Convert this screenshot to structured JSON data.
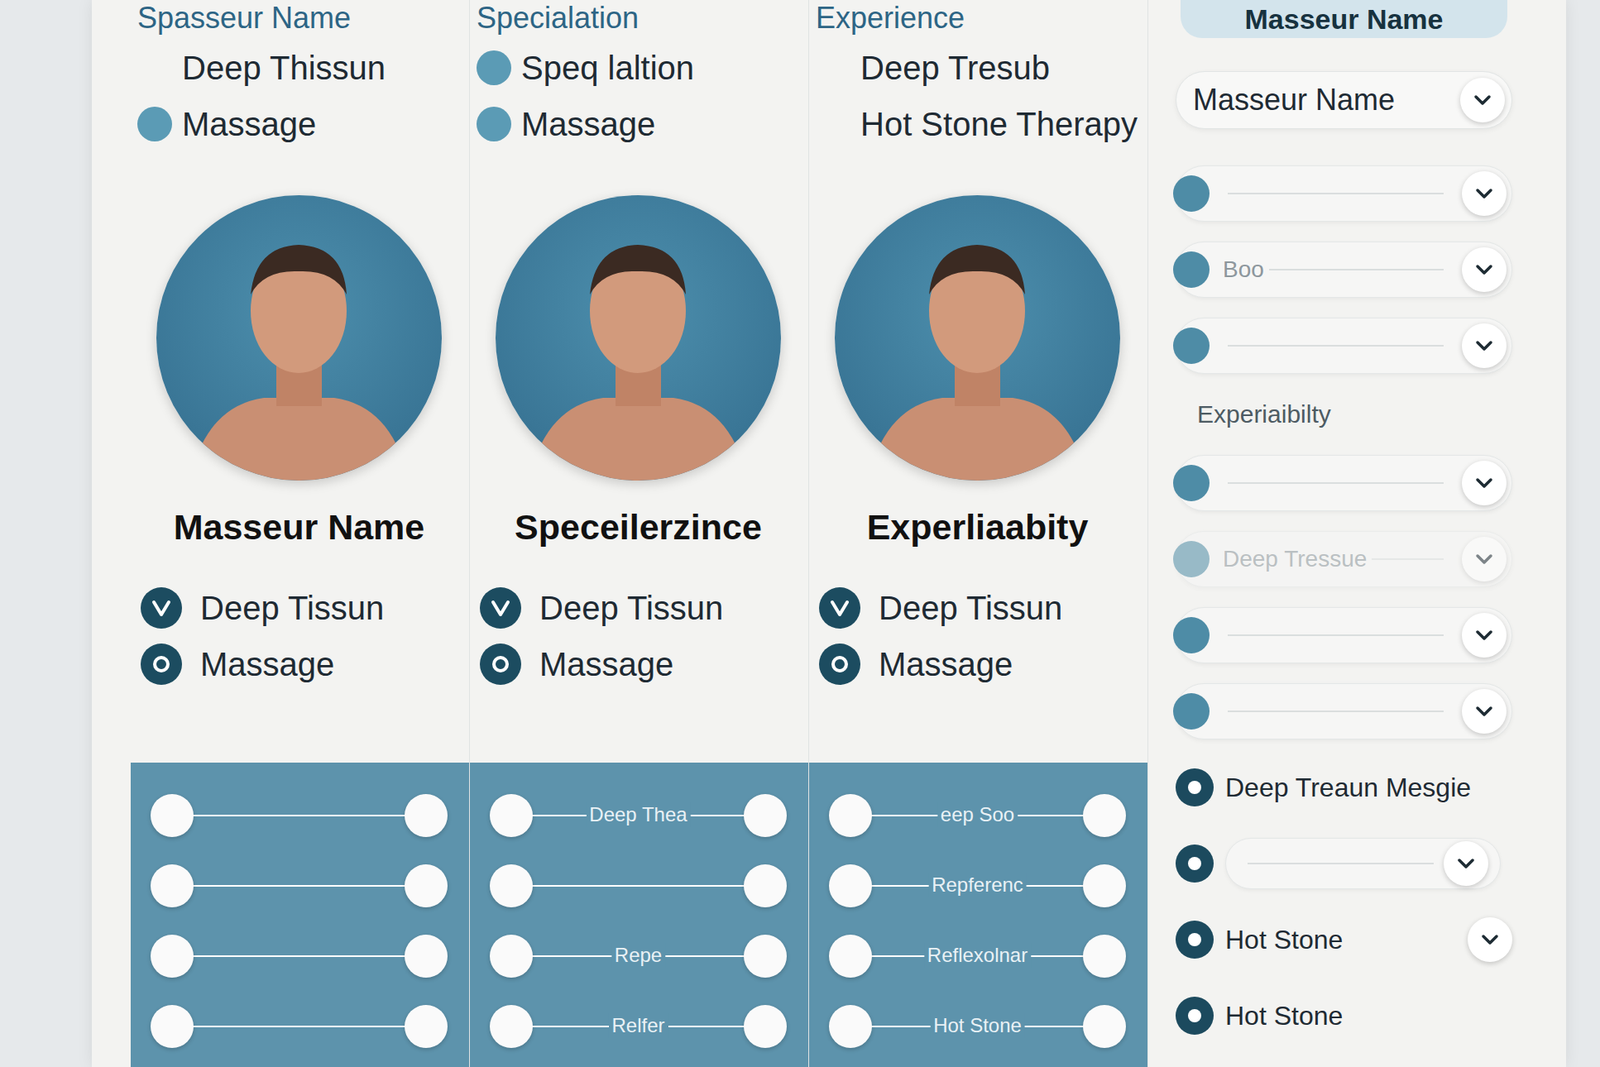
{
  "columns": [
    {
      "header": "Spasseur Name",
      "top_items": [
        {
          "text": "Deep Thissun",
          "bullet": false
        },
        {
          "text": "Massage",
          "bullet": true
        }
      ],
      "name": "Masseur Name",
      "items": [
        "Deep Tissun",
        "Massage"
      ],
      "sliders": [
        {
          "label": "",
          "level": 1
        },
        {
          "label": "",
          "level": 1
        },
        {
          "label": "",
          "level": 1
        },
        {
          "label": "",
          "level": 1
        }
      ]
    },
    {
      "header": "Specialation",
      "top_items": [
        {
          "text": "Speq laltion",
          "bullet": true
        },
        {
          "text": "Massage",
          "bullet": true
        }
      ],
      "name": "Speceilerzince",
      "items": [
        "Deep Tissun",
        "Massage"
      ],
      "sliders": [
        {
          "label": "Deep Thea",
          "level": 1
        },
        {
          "label": "",
          "level": 1
        },
        {
          "label": "Repe",
          "level": 1
        },
        {
          "label": "Relfer",
          "level": 1
        }
      ]
    },
    {
      "header": "Experience",
      "top_items": [
        {
          "text": "Deep Tresub",
          "bullet": false
        },
        {
          "text": "Hot Stone Therapy",
          "bullet": false
        }
      ],
      "name": "Experliaabity",
      "items": [
        "Deep Tissun",
        "Massage"
      ],
      "sliders": [
        {
          "label": "eep Soo",
          "level": 1
        },
        {
          "label": "Repferenc",
          "level": 1
        },
        {
          "label": "Reflexolnar",
          "level": 1
        },
        {
          "label": "Hot Stone",
          "level": 1
        }
      ]
    }
  ],
  "sidebar": {
    "title": "Masseur Name",
    "dropdown": "Masseur Name",
    "rows": [
      {
        "kind": "field",
        "text": "",
        "disabled": false
      },
      {
        "kind": "field",
        "text": "Boo",
        "disabled": false
      },
      {
        "kind": "field",
        "text": "",
        "disabled": false
      },
      {
        "kind": "label",
        "text": "Experiaibilty"
      },
      {
        "kind": "field",
        "text": "",
        "disabled": false
      },
      {
        "kind": "field",
        "text": "Deep Tressue",
        "disabled": true
      },
      {
        "kind": "field",
        "text": "",
        "disabled": false
      },
      {
        "kind": "field",
        "text": "",
        "disabled": false
      },
      {
        "kind": "radio",
        "text": "Deep Treaun Mesgie",
        "selected": true,
        "chevron": false
      },
      {
        "kind": "radio-field",
        "text": "",
        "selected": true,
        "chevron": true
      },
      {
        "kind": "radio",
        "text": "Hot Stone",
        "selected": true,
        "chevron": true
      },
      {
        "kind": "radio",
        "text": "Hot Stone",
        "selected": true,
        "chevron": false
      }
    ]
  }
}
